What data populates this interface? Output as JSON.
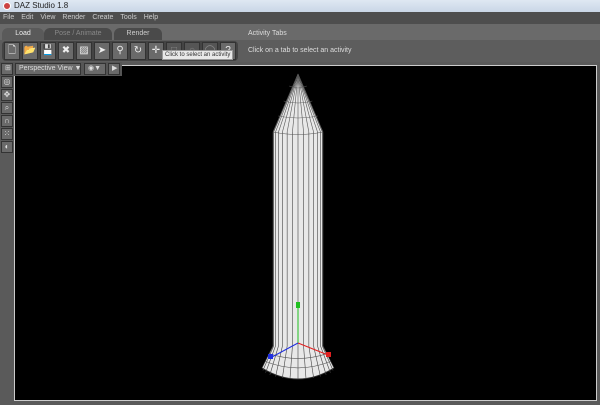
{
  "window": {
    "title": "DAZ Studio 1.8"
  },
  "menu": [
    "File",
    "Edit",
    "View",
    "Render",
    "Create",
    "Tools",
    "Help"
  ],
  "tabs": [
    {
      "label": "Load",
      "active": true
    },
    {
      "label": "Pose / Animate",
      "active": false
    },
    {
      "label": "Render",
      "active": false
    }
  ],
  "activity": {
    "title": "Activity Tabs",
    "hint": "Click on a tab to select an activity",
    "tooltip": "Click to select an activity"
  },
  "toolbar": [
    {
      "icon": "new-file-icon",
      "glyph": "🗋"
    },
    {
      "icon": "open-folder-icon",
      "glyph": "📂"
    },
    {
      "icon": "save-icon",
      "glyph": "💾"
    },
    {
      "icon": "delete-icon",
      "glyph": "✖"
    },
    {
      "icon": "image-icon",
      "glyph": "▨"
    },
    {
      "icon": "select-arrow-icon",
      "glyph": "➤"
    },
    {
      "icon": "bone-icon",
      "glyph": "⚲"
    },
    {
      "icon": "rotate-icon",
      "glyph": "↻"
    },
    {
      "icon": "move-icon",
      "glyph": "✛"
    },
    {
      "icon": "box-icon",
      "glyph": "□"
    },
    {
      "icon": "sphere-icon",
      "glyph": "○"
    },
    {
      "icon": "circle-icon",
      "glyph": "◯"
    },
    {
      "icon": "help-icon",
      "glyph": "?"
    }
  ],
  "viewbar": {
    "view": "Perspective View",
    "arrow": "▼",
    "play": "▶"
  },
  "left_tools": [
    {
      "icon": "orbit-icon",
      "glyph": "◎"
    },
    {
      "icon": "pan-icon",
      "glyph": "✥"
    },
    {
      "icon": "zoom-icon",
      "glyph": "⌕"
    },
    {
      "icon": "roll-icon",
      "glyph": "∩"
    },
    {
      "icon": "frame-icon",
      "glyph": "⁙"
    },
    {
      "icon": "camera-icon",
      "glyph": "◐"
    }
  ],
  "colors": {
    "x_axis": "#e02020",
    "y_axis": "#20c020",
    "z_axis": "#2030e0",
    "mesh": "#ffffff"
  }
}
